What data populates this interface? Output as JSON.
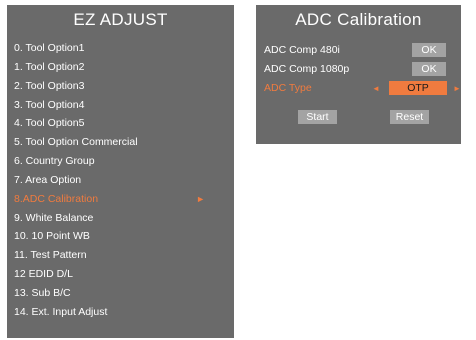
{
  "ez_adjust": {
    "title": "EZ ADJUST",
    "items": [
      {
        "label": "0. Tool Option1"
      },
      {
        "label": "1. Tool Option2"
      },
      {
        "label": "2. Tool Option3"
      },
      {
        "label": "3. Tool Option4"
      },
      {
        "label": "4. Tool Option5"
      },
      {
        "label": "5. Tool Option Commercial"
      },
      {
        "label": "6. Country Group"
      },
      {
        "label": "7. Area Option"
      },
      {
        "label": "8.ADC Calibration"
      },
      {
        "label": "9. White Balance"
      },
      {
        "label": "10. 10 Point WB"
      },
      {
        "label": "11. Test Pattern"
      },
      {
        "label": "12 EDID D/L"
      },
      {
        "label": "13. Sub B/C"
      },
      {
        "label": "14. Ext. Input Adjust"
      }
    ],
    "selected_index": 8,
    "selected_arrow": "►"
  },
  "adc": {
    "title": "ADC Calibration",
    "rows": [
      {
        "label": "ADC Comp 480i",
        "value": "OK"
      },
      {
        "label": "ADC Comp 1080p",
        "value": "OK"
      }
    ],
    "type": {
      "label": "ADC Type",
      "value": "OTP",
      "left_arrow": "◄",
      "right_arrow": "►"
    },
    "start_label": "Start",
    "reset_label": "Reset"
  },
  "colors": {
    "panel_bg": "#6a6a6a",
    "highlight": "#f07b3f",
    "value_box": "#a3a3a3"
  }
}
